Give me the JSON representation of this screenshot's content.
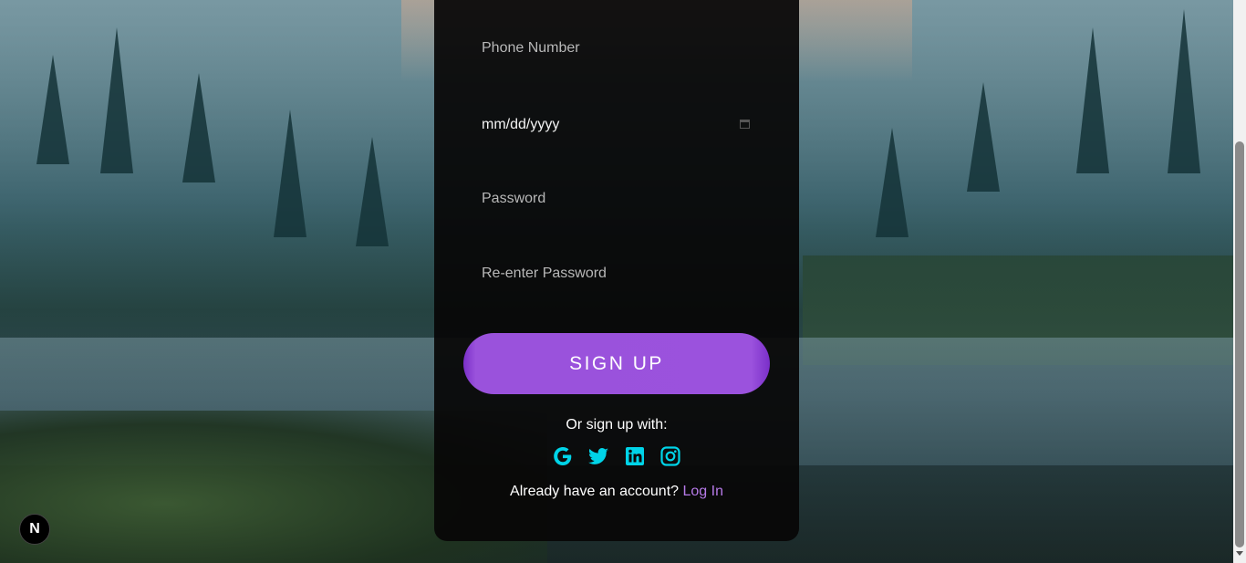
{
  "form": {
    "phone_placeholder": "Phone Number",
    "date_value": "mm/dd/yyyy",
    "password_placeholder": "Password",
    "reenter_password_placeholder": "Re-enter Password",
    "signup_label": "SIGN UP",
    "or_text": "Or sign up with:",
    "socials": [
      {
        "icon": "google-icon"
      },
      {
        "icon": "twitter-icon"
      },
      {
        "icon": "linkedin-icon"
      },
      {
        "icon": "instagram-icon"
      }
    ],
    "already_text": "Already have an account?",
    "login_label": "Log In"
  },
  "badge": {
    "label": "N"
  },
  "colors": {
    "accent": "#9b52dd",
    "social": "#00d4e8",
    "link": "#b67ae8"
  }
}
